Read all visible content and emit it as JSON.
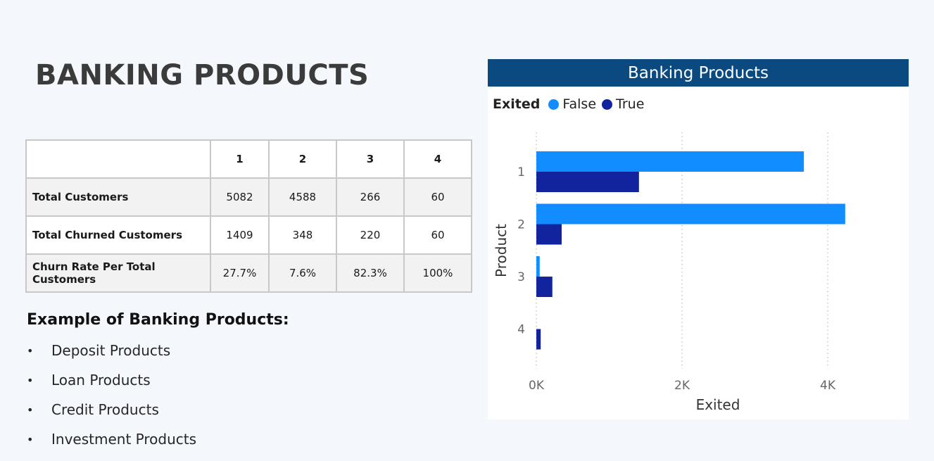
{
  "page": {
    "title": "BANKING PRODUCTS"
  },
  "table": {
    "header": [
      "",
      "1",
      "2",
      "3",
      "4"
    ],
    "rows": [
      {
        "label": "Total Customers",
        "values": [
          "5082",
          "4588",
          "266",
          "60"
        ]
      },
      {
        "label": "Total Churned Customers",
        "values": [
          "1409",
          "348",
          "220",
          "60"
        ]
      },
      {
        "label": "Churn Rate Per Total Customers",
        "values": [
          "27.7%",
          "7.6%",
          "82.3%",
          "100%"
        ]
      }
    ]
  },
  "examples": {
    "heading": "Example of Banking Products:",
    "bullet": "•",
    "items": [
      "Deposit Products",
      "Loan Products",
      "Credit Products",
      "Investment Products"
    ]
  },
  "chart_data": {
    "type": "bar",
    "orientation": "horizontal",
    "title": "Banking Products",
    "xlabel": "Exited",
    "ylabel": "Product",
    "categories": [
      "1",
      "2",
      "3",
      "4"
    ],
    "series": [
      {
        "name": "False",
        "color": "#118dff",
        "values": [
          3673,
          4240,
          46,
          0
        ]
      },
      {
        "name": "True",
        "color": "#12239e",
        "values": [
          1409,
          348,
          220,
          60
        ]
      }
    ],
    "legend": {
      "title": "Exited",
      "position": "top-left"
    },
    "x_ticks": [
      "0K",
      "2K",
      "4K"
    ],
    "x_tick_values": [
      0,
      2000,
      4000
    ],
    "xlim": [
      0,
      4750
    ],
    "grid": "vertical-dotted"
  },
  "colors": {
    "header_bg": "#0b4a80",
    "false_series": "#118dff",
    "true_series": "#12239e",
    "page_bg": "#f4f8fd"
  }
}
